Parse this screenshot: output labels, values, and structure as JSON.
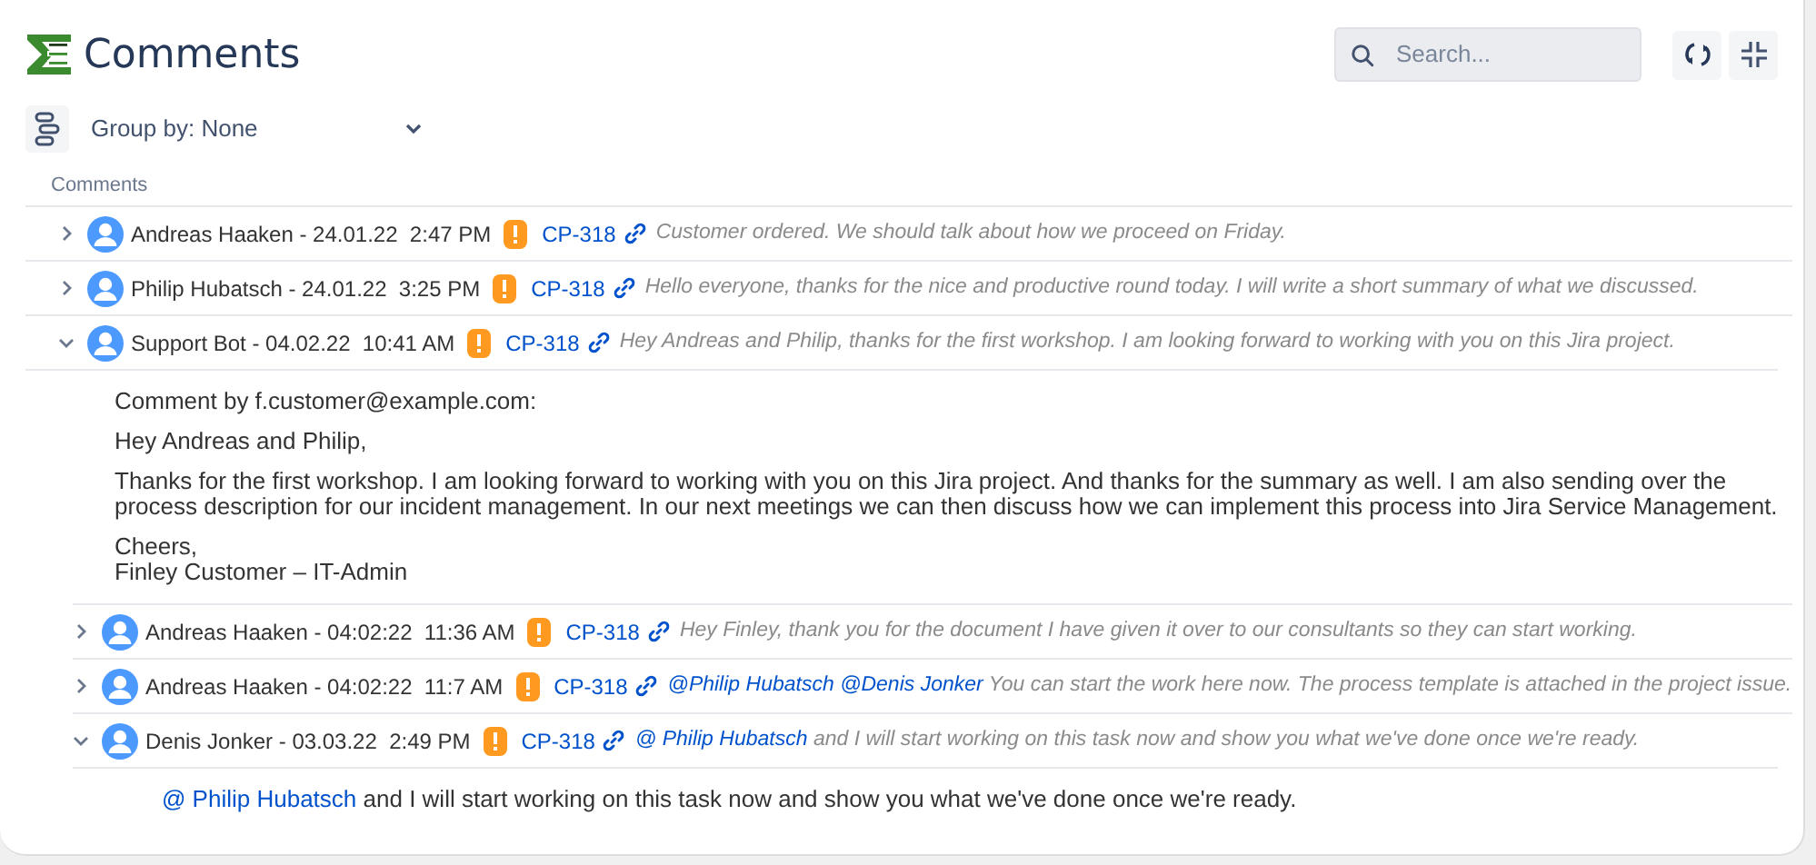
{
  "header": {
    "title": "Comments",
    "search": {
      "placeholder": "Search..."
    }
  },
  "group_by": {
    "label": "Group by: None"
  },
  "list_heading": "Comments",
  "comments": [
    {
      "author": "Andreas Haaken - 24.01.22  2:47 PM",
      "issue": "CP-318",
      "expanded": false,
      "preview": [
        {
          "kind": "text",
          "text": "Customer ordered. We should talk about how we proceed on Friday."
        }
      ]
    },
    {
      "author": "Philip Hubatsch - 24.01.22  3:25 PM",
      "issue": "CP-318",
      "expanded": false,
      "preview": [
        {
          "kind": "text",
          "text": "Hello everyone, thanks for the nice and productive round today. I will write a short summary of what we discussed."
        }
      ]
    },
    {
      "author": "Support Bot - 04.02.22  10:41 AM",
      "issue": "CP-318",
      "expanded": true,
      "preview": [
        {
          "kind": "text",
          "text": "Hey Andreas and Philip, thanks for the first workshop. I am looking forward to working with you on this Jira project."
        }
      ],
      "body": [
        [
          {
            "kind": "text",
            "text": "Comment by f.customer@example.com:"
          }
        ],
        [
          {
            "kind": "text",
            "text": "Hey Andreas and Philip,"
          }
        ],
        [
          {
            "kind": "text",
            "text": "Thanks for the first workshop. I am looking forward to working with you on this Jira project. And thanks for the summary as well. I am also sending over the process description for our incident management. In our next meetings we can then discuss how we can implement this process into Jira Service Management."
          }
        ],
        [
          {
            "kind": "text",
            "text": "Cheers,\nFinley Customer  – IT-Admin"
          }
        ]
      ],
      "children": [
        {
          "author": "Andreas Haaken - 04:02:22  11:36 AM",
          "issue": "CP-318",
          "expanded": false,
          "preview": [
            {
              "kind": "text",
              "text": "Hey Finley, thank you for the document I have given it over to our consultants so they can start working."
            }
          ]
        },
        {
          "author": "Andreas Haaken - 04:02:22  11:7 AM",
          "issue": "CP-318",
          "expanded": false,
          "preview": [
            {
              "kind": "mention",
              "text": "@Philip Hubatsch"
            },
            {
              "kind": "mention",
              "text": "@Denis Jonker"
            },
            {
              "kind": "text",
              "text": "You can start the work here now. The process template is attached in the project issue."
            }
          ]
        },
        {
          "author": "Denis Jonker - 03.03.22  2:49 PM",
          "issue": "CP-318",
          "expanded": true,
          "preview": [
            {
              "kind": "mention",
              "text": "@ Philip Hubatsch"
            },
            {
              "kind": "text",
              "text": "and I will start working on this task now and show you what we've done once we're ready."
            }
          ],
          "body": [
            [
              {
                "kind": "mention",
                "text": "@ Philip Hubatsch"
              },
              {
                "kind": "text",
                "text": "and I will start working on this task now and show you what we've done once we're ready."
              }
            ]
          ]
        }
      ]
    }
  ]
}
